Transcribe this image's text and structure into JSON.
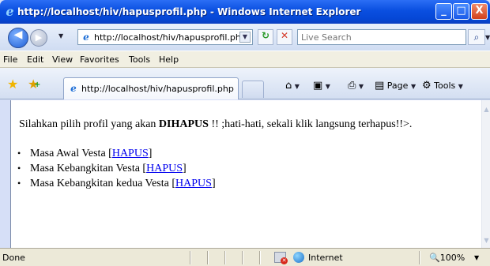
{
  "window": {
    "title": "http://localhost/hiv/hapusprofil.php - Windows Internet Explorer",
    "minimize": "_",
    "maximize": "□",
    "close": "X"
  },
  "addressbar": {
    "url": "http://localhost/hiv/hapusprofil.php",
    "search_placeholder": "Live Search",
    "back_glyph": "◀",
    "forward_glyph": "▶",
    "refresh_glyph": "↻",
    "stop_glyph": "✕",
    "search_glyph": "⌕"
  },
  "menubar": {
    "items": [
      "File",
      "Edit",
      "View",
      "Favorites",
      "Tools",
      "Help"
    ]
  },
  "tabbar": {
    "tab_label": "http://localhost/hiv/hapusprofil.php",
    "commands": {
      "page": "Page",
      "tools": "Tools"
    }
  },
  "content": {
    "intro_before": "Silahkan pilih profil yang akan ",
    "intro_bold": "DIHAPUS",
    "intro_after": " !! ;hati-hati, sekali klik langsung terhapus!!>.",
    "profiles": [
      {
        "name": "Masa Awal Vesta [",
        "link": "HAPUS",
        "close": "]"
      },
      {
        "name": "Masa Kebangkitan Vesta [",
        "link": "HAPUS",
        "close": "]"
      },
      {
        "name": "Masa Kebangkitan kedua Vesta [",
        "link": "HAPUS",
        "close": "]"
      }
    ]
  },
  "statusbar": {
    "status": "Done",
    "zone": "Internet",
    "zoom": "100%"
  },
  "icons": {
    "ie_logo": "ie-logo-icon",
    "favorites": "star-icon",
    "add_favorite": "add-favorite-icon",
    "home": "home-icon",
    "feeds": "feed-icon",
    "print": "print-icon",
    "page": "page-icon",
    "tools": "gear-icon",
    "internet_zone": "globe-icon"
  }
}
